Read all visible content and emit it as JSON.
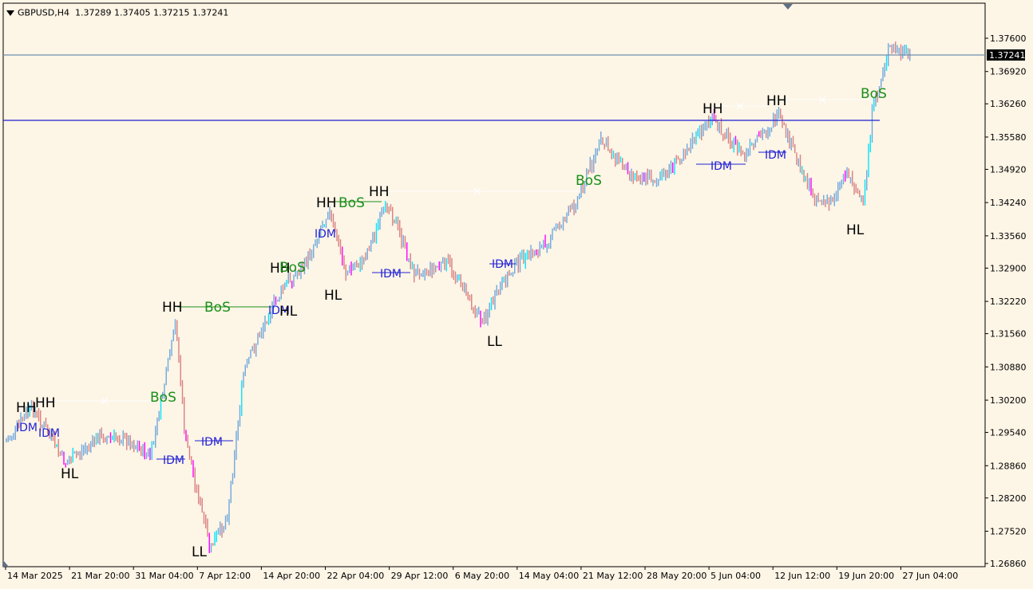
{
  "header": {
    "symbol_tf": "GBPUSD,H4",
    "ohlc": "1.37289 1.37405 1.37215 1.37241"
  },
  "colors": {
    "background": "#fdf5e6",
    "bull": "#6fa8dc",
    "bear": "#d98080",
    "bull_highlight": "#00e5ff",
    "bear_highlight": "#ff00ff",
    "bid_line": "#6e8fb0",
    "level_line": "#1f1fd1",
    "bos": "#1a8f1a",
    "idm": "#2323d6",
    "structure_text": "#000000",
    "dashed_level": "#ffffff"
  },
  "price_axis": {
    "ticks": [
      "1.37600",
      "1.36920",
      "1.36260",
      "1.35580",
      "1.34920",
      "1.34240",
      "1.33560",
      "1.32900",
      "1.32220",
      "1.31560",
      "1.30880",
      "1.30200",
      "1.29540",
      "1.28860",
      "1.28200",
      "1.27520",
      "1.26860"
    ],
    "current_price": "1.37241"
  },
  "time_axis": {
    "ticks": [
      "14 Mar 2025",
      "21 Mar 20:00",
      "31 Mar 04:00",
      "7 Apr 12:00",
      "14 Apr 20:00",
      "22 Apr 04:00",
      "29 Apr 12:00",
      "6 May 20:00",
      "14 May 04:00",
      "21 May 12:00",
      "28 May 20:00",
      "5 Jun 04:00",
      "12 Jun 12:00",
      "19 Jun 20:00",
      "27 Jun 04:00"
    ]
  },
  "chart_data": {
    "type": "candlestick",
    "series_anchor_points": [
      {
        "date": "14 Mar 2025",
        "price": 1.2935
      },
      {
        "date": "17 Mar 2025",
        "price": 1.3005
      },
      {
        "date": "19 Mar 2025",
        "price": 1.295
      },
      {
        "date": "21 Mar 2025",
        "price": 1.289
      },
      {
        "date": "25 Mar 2025",
        "price": 1.2945
      },
      {
        "date": "28 Mar 2025",
        "price": 1.294
      },
      {
        "date": "31 Mar 2025",
        "price": 1.2905
      },
      {
        "date": "3 Apr 2025",
        "price": 1.318
      },
      {
        "date": "4 Apr 2025",
        "price": 1.295
      },
      {
        "date": "7 Apr 2025",
        "price": 1.2715
      },
      {
        "date": "9 Apr 2025",
        "price": 1.278
      },
      {
        "date": "11 Apr 2025",
        "price": 1.308
      },
      {
        "date": "14 Apr 2025",
        "price": 1.32
      },
      {
        "date": "16 Apr 2025",
        "price": 1.326
      },
      {
        "date": "18 Apr 2025",
        "price": 1.329
      },
      {
        "date": "21 Apr 2025",
        "price": 1.341
      },
      {
        "date": "23 Apr 2025",
        "price": 1.328
      },
      {
        "date": "25 Apr 2025",
        "price": 1.3305
      },
      {
        "date": "28 Apr 2025",
        "price": 1.3425
      },
      {
        "date": "1 May 2025",
        "price": 1.328
      },
      {
        "date": "5 May 2025",
        "price": 1.33
      },
      {
        "date": "7 May 2025",
        "price": 1.325
      },
      {
        "date": "9 May 2025",
        "price": 1.318
      },
      {
        "date": "13 May 2025",
        "price": 1.33
      },
      {
        "date": "16 May 2025",
        "price": 1.333
      },
      {
        "date": "20 May 2025",
        "price": 1.342
      },
      {
        "date": "23 May 2025",
        "price": 1.355
      },
      {
        "date": "27 May 2025",
        "price": 1.348
      },
      {
        "date": "30 May 2025",
        "price": 1.347
      },
      {
        "date": "3 Jun 2025",
        "price": 1.355
      },
      {
        "date": "5 Jun 2025",
        "price": 1.3595
      },
      {
        "date": "9 Jun 2025",
        "price": 1.352
      },
      {
        "date": "11 Jun 2025",
        "price": 1.356
      },
      {
        "date": "13 Jun 2025",
        "price": 1.36
      },
      {
        "date": "17 Jun 2025",
        "price": 1.344
      },
      {
        "date": "19 Jun 2025",
        "price": 1.342
      },
      {
        "date": "21 Jun 2025",
        "price": 1.349
      },
      {
        "date": "23 Jun 2025",
        "price": 1.342
      },
      {
        "date": "24 Jun 2025",
        "price": 1.36
      },
      {
        "date": "26 Jun 2025",
        "price": 1.374
      },
      {
        "date": "28 Jun 2025",
        "price": 1.3724
      }
    ],
    "annotations": [
      {
        "text": "HH",
        "kind": "structure",
        "date": "15 Mar 2025",
        "price": 1.3014
      },
      {
        "text": "HH",
        "kind": "structure",
        "date": "17 Mar 2025",
        "price": 1.3022
      },
      {
        "text": "HL",
        "kind": "structure",
        "date": "21 Mar 2025",
        "price": 1.2853
      },
      {
        "text": "IDM",
        "kind": "idm",
        "date": "15 Mar 2025",
        "price": 1.297
      },
      {
        "text": "IDM",
        "kind": "idm",
        "date": "17 Mar 2025",
        "price": 1.2962
      },
      {
        "text": "BoS",
        "kind": "bos",
        "date": "29 Mar 2025",
        "price": 1.3023
      },
      {
        "text": "IDM",
        "kind": "idm",
        "date": "2 Apr 2025",
        "price": 1.2895
      },
      {
        "text": "IDM",
        "kind": "idm",
        "date": "8 Apr 2025",
        "price": 1.2932
      },
      {
        "text": "HH",
        "kind": "structure",
        "date": "4 Apr 2025",
        "price": 1.3215
      },
      {
        "text": "BoS",
        "kind": "bos",
        "date": "10 Apr 2025",
        "price": 1.3215
      },
      {
        "text": "LL",
        "kind": "structure",
        "date": "7 Apr 2025",
        "price": 1.2685
      },
      {
        "text": "IDM",
        "kind": "idm",
        "date": "18 Apr 2025",
        "price": 1.3215
      },
      {
        "text": "HL",
        "kind": "structure",
        "date": "18 Apr 2025",
        "price": 1.3215
      },
      {
        "text": "HH",
        "kind": "structure",
        "date": "17 Apr 2025",
        "price": 1.3295
      },
      {
        "text": "BoS",
        "kind": "bos",
        "date": "18 Apr 2025",
        "price": 1.3295
      },
      {
        "text": "IDM",
        "kind": "idm",
        "date": "22 Apr 2025",
        "price": 1.3375
      },
      {
        "text": "HH",
        "kind": "structure",
        "date": "22 Apr 2025",
        "price": 1.3423
      },
      {
        "text": "BoS",
        "kind": "bos",
        "date": "24 Apr 2025",
        "price": 1.3423
      },
      {
        "text": "HL",
        "kind": "structure",
        "date": "24 Apr 2025",
        "price": 1.326
      },
      {
        "text": "HH",
        "kind": "structure",
        "date": "28 Apr 2025",
        "price": 1.344
      },
      {
        "text": "IDM",
        "kind": "idm",
        "date": "1 May 2025",
        "price": 1.3285
      },
      {
        "text": "LL",
        "kind": "structure",
        "date": "9 May 2025",
        "price": 1.315
      },
      {
        "text": "IDM",
        "kind": "idm",
        "date": "11 May 2025",
        "price": 1.3297
      },
      {
        "text": "BoS",
        "kind": "bos",
        "date": "19 May 2025",
        "price": 1.3448
      },
      {
        "text": "HH",
        "kind": "structure",
        "date": "5 Jun 2025",
        "price": 1.3625
      },
      {
        "text": "IDM",
        "kind": "idm",
        "date": "6 Jun 2025",
        "price": 1.3493
      },
      {
        "text": "HH",
        "kind": "structure",
        "date": "11 Jun 2025",
        "price": 1.3633
      },
      {
        "text": "IDM",
        "kind": "idm",
        "date": "11 Jun 2025",
        "price": 1.3508
      },
      {
        "text": "HL",
        "kind": "structure",
        "date": "22 Jun 2025",
        "price": 1.335
      },
      {
        "text": "BoS",
        "kind": "bos",
        "date": "24 Jun 2025",
        "price": 1.3641
      }
    ]
  }
}
